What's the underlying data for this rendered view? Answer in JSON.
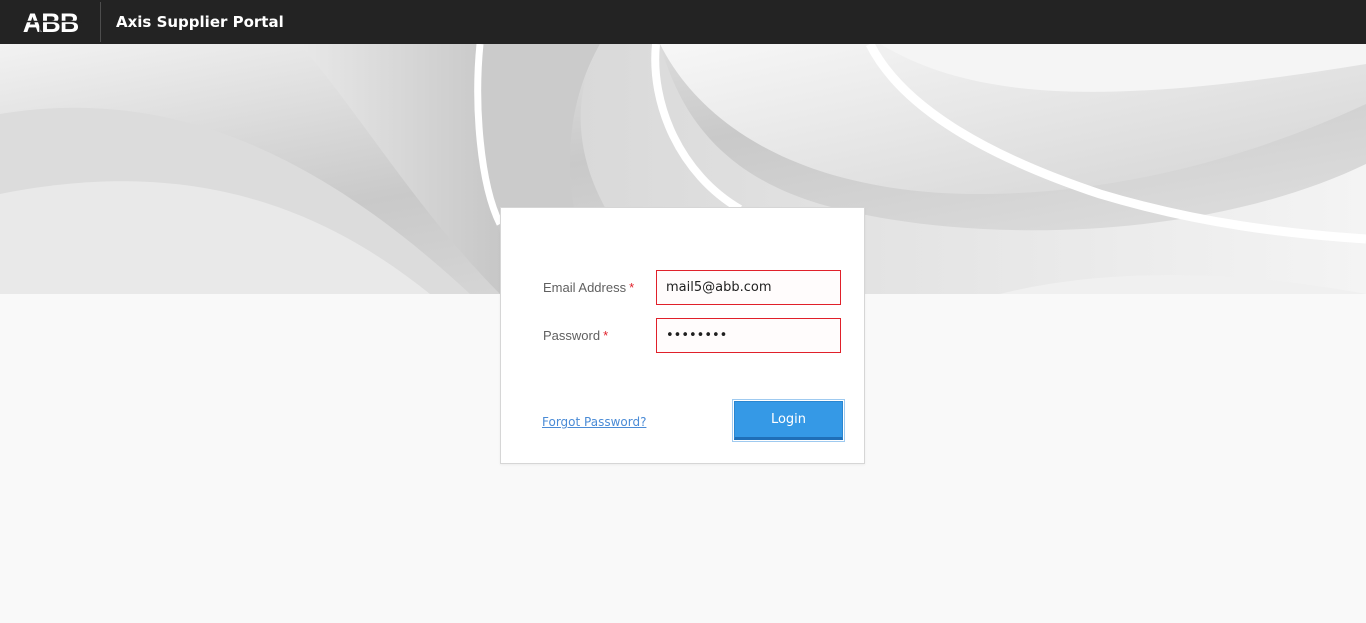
{
  "header": {
    "logo_text": "ABB",
    "title": "Axis Supplier Portal"
  },
  "login_form": {
    "email": {
      "label": "Email Address",
      "required_mark": "*",
      "value": "mail5@abb.com"
    },
    "password": {
      "label": "Password",
      "required_mark": "*",
      "value": "abcd1234"
    },
    "forgot_password_link": "Forgot Password?",
    "login_button": "Login"
  },
  "colors": {
    "topbar": "#232323",
    "accent": "#3599e6",
    "error_border": "#e0202a",
    "link": "#4a8bd6"
  }
}
